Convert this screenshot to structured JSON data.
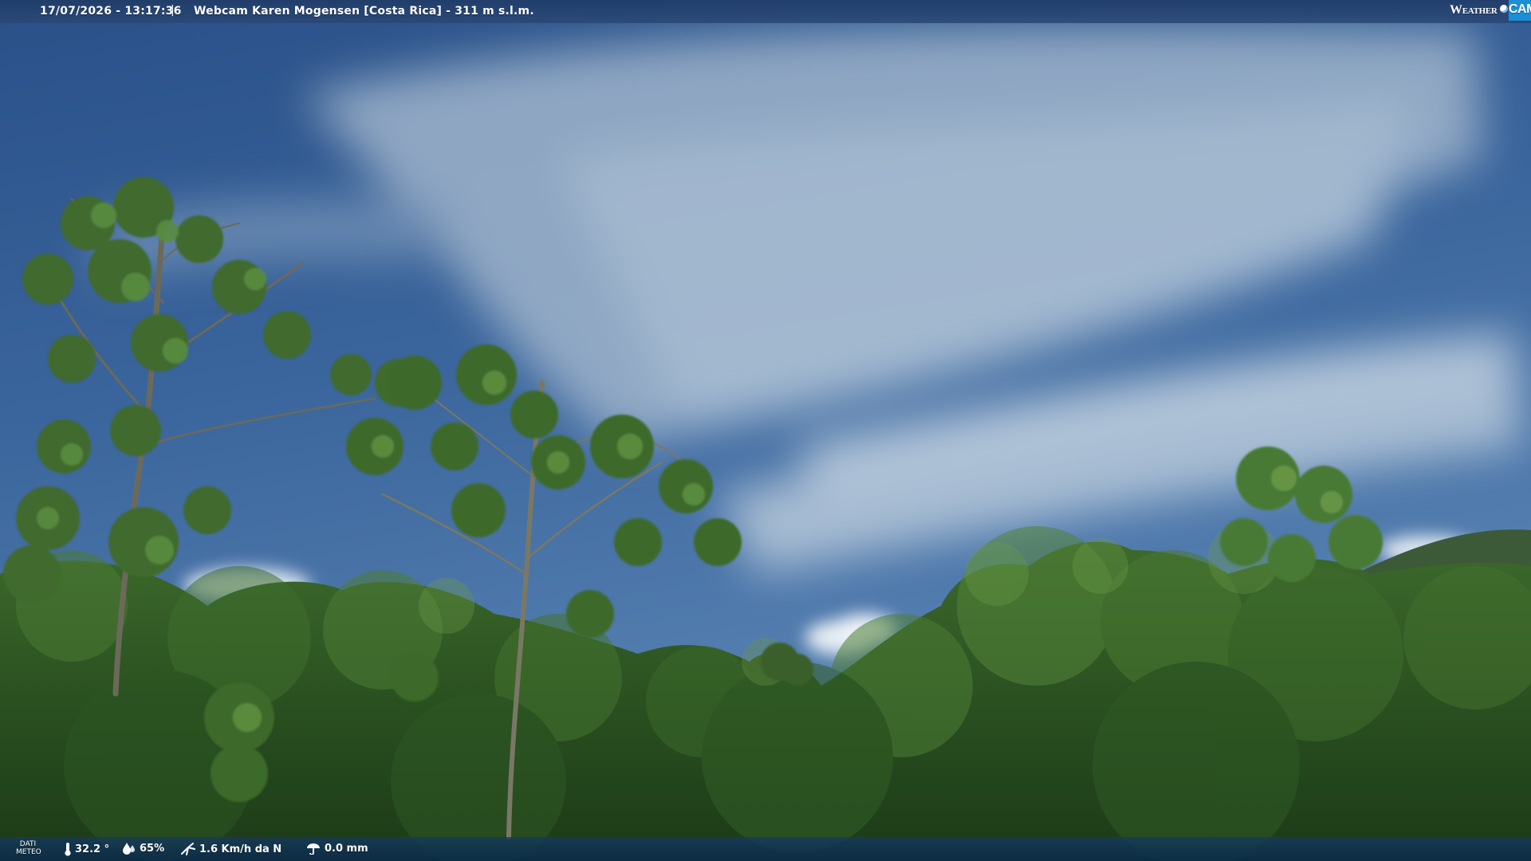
{
  "overlay": {
    "datetime": "17/07/2026 - 13:17:36",
    "separator": "|",
    "title": "Webcam Karen Mogensen [Costa Rica] - 311 m s.l.m.",
    "logo": {
      "weather": "Weather",
      "cam": "CAM",
      "accent_color": "#1a8fd6"
    }
  },
  "weather_bar": {
    "label_line1": "DATI",
    "label_line2": "METEO",
    "temperature": "32.2 °",
    "humidity": "65%",
    "wind": "1.6 Km/h da N",
    "rain": "0.0 mm",
    "icons": [
      "thermometer-icon",
      "humidity-drop-icon",
      "wind-icon",
      "rain-icon"
    ]
  },
  "scene": {
    "sky_color": "#2f5a93",
    "cloud_color": "#a9bed3",
    "foliage_color": "#2b5a22"
  }
}
